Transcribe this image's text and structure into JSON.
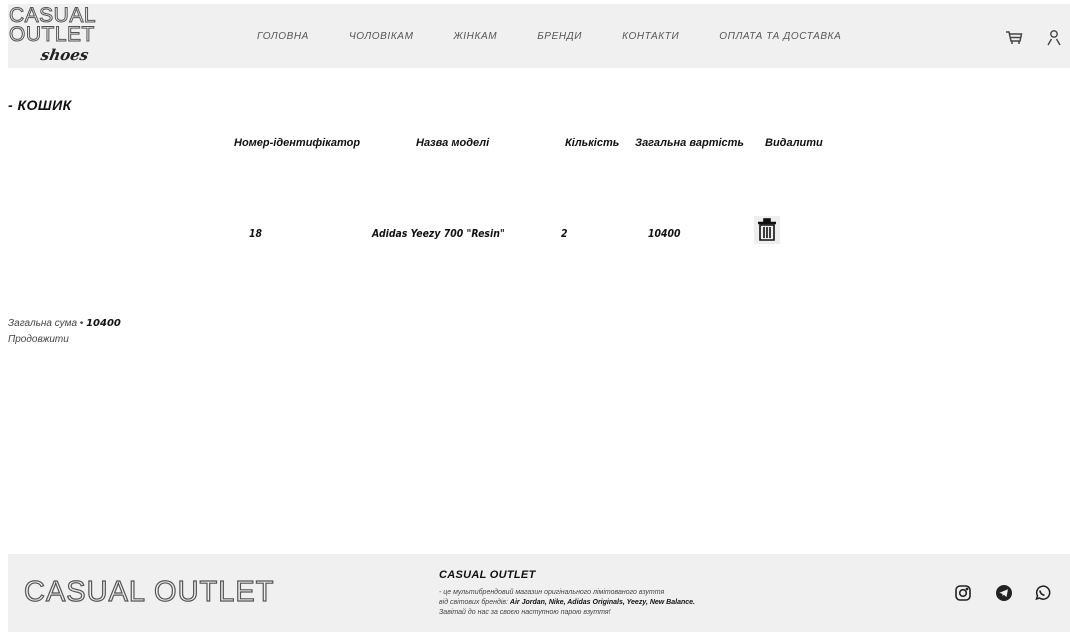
{
  "header": {
    "logo_line1": "CASUAL",
    "logo_line2": "OUTLET",
    "logo_line3": "shoes",
    "nav": [
      "ГОЛОВНА",
      "ЧОЛОВІКАМ",
      "ЖІНКАМ",
      "БРЕНДИ",
      "КОНТАКТИ",
      "ОПЛАТА ТА ДОСТАВКА"
    ],
    "icons": [
      "cart-icon",
      "user-icon"
    ]
  },
  "cart": {
    "title": "- КОШИК",
    "columns": [
      "Номер-ідентифікатор",
      "Назва моделі",
      "Кількість",
      "Загальна вартість",
      "Видалити"
    ],
    "rows": [
      {
        "id": "18",
        "model": "Adidas Yeezy 700 \"Resin\"",
        "qty": "2",
        "total": "10400"
      }
    ],
    "total_label": "Загальна сума • ",
    "total_value": "10400",
    "continue": "Продовжити"
  },
  "footer": {
    "logo": "CASUAL OUTLET",
    "title": "CASUAL OUTLET",
    "line1": "- це мультибрендовий магазин оригінального лімітованого взуття",
    "line2_prefix": "від світових брендів: ",
    "line2_brands": "Air Jordan, Nike, Adidas Originals, Yeezy, New Balance.",
    "line3": "Завітай до нас за своєю наступною парою взуття!",
    "social_icons": [
      "instagram-icon",
      "telegram-icon",
      "whatsapp-icon"
    ]
  }
}
